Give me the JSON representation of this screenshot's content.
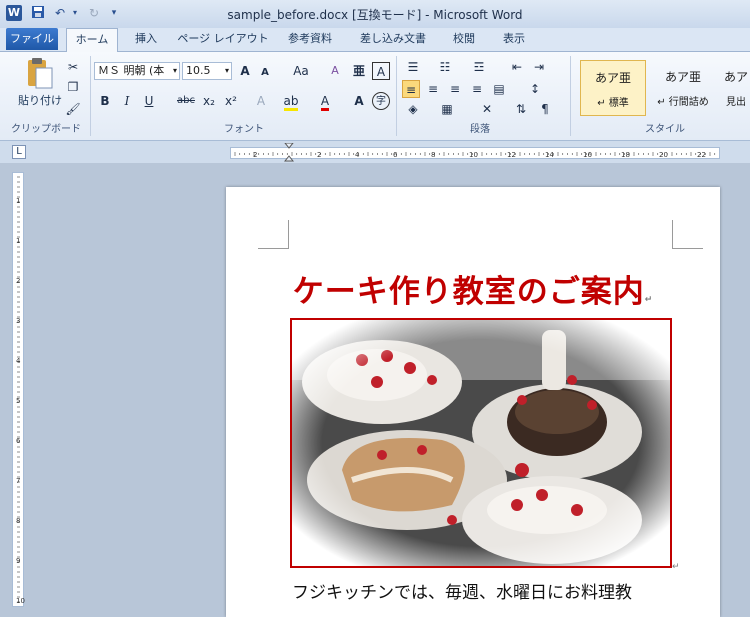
{
  "window": {
    "title": "sample_before.docx [互換モード] - Microsoft Word",
    "app_icon": "W",
    "qa_save": "save-icon",
    "qa_undo": "undo-icon",
    "qa_redo": "redo-icon"
  },
  "tabs": {
    "file": "ファイル",
    "home": "ホーム",
    "items": [
      "挿入",
      "ページ レイアウト",
      "参考資料",
      "差し込み文書",
      "校閲",
      "表示"
    ]
  },
  "clipboard": {
    "paste_label": "貼り付け",
    "group_label": "クリップボード"
  },
  "font": {
    "name": "ＭＳ 明朝 (本",
    "size": "10.5",
    "group_label": "フォント",
    "bold": "B",
    "italic": "I",
    "underline": "U",
    "strike": "abc",
    "sub": "x₂",
    "sup": "x²",
    "case": "Aa",
    "grow": "A",
    "shrink": "A",
    "clear": "A",
    "char_border": "A",
    "enclose": "字"
  },
  "paragraph": {
    "group_label": "段落"
  },
  "styles": {
    "group_label": "スタイル",
    "items": [
      {
        "sample": "あア亜",
        "name": "標準"
      },
      {
        "sample": "あア亜",
        "name": "行間詰め"
      },
      {
        "sample": "あア",
        "name": "見出"
      }
    ]
  },
  "ruler": {
    "h_ticks": [
      "2",
      "2",
      "4",
      "6",
      "8",
      "10",
      "12",
      "14",
      "16",
      "18",
      "20",
      "22"
    ],
    "v_ticks": [
      "1",
      "1",
      "2",
      "3",
      "4",
      "5",
      "6",
      "7",
      "8",
      "9",
      "10"
    ],
    "corner": "L"
  },
  "document": {
    "title": "ケーキ作り教室のご案内",
    "paragraph_mark": "↵",
    "body_line": "フジキッチンでは、毎週、水曜日にお料理教"
  },
  "colors": {
    "title_red": "#c00000",
    "frame_red": "#c00000",
    "file_tab": "#2b5fad"
  }
}
